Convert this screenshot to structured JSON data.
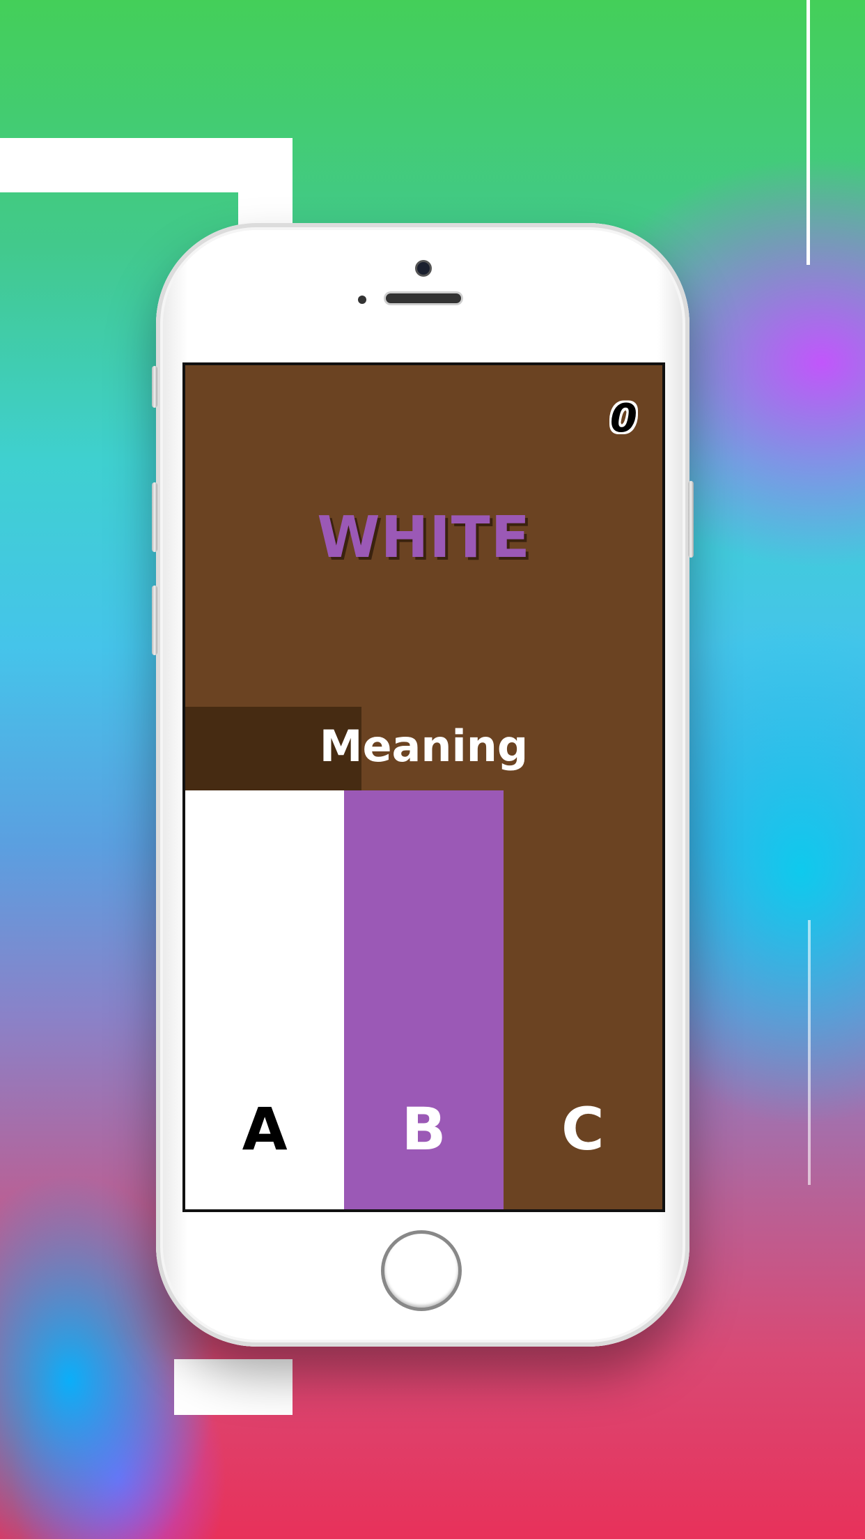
{
  "game": {
    "score": "0",
    "word": "WHITE",
    "mode_label": "Meaning",
    "timer_fraction": 0.37
  },
  "answers": [
    {
      "label": "A",
      "color": "#ffffff",
      "text_color": "#000000"
    },
    {
      "label": "B",
      "color": "#9b59b6",
      "text_color": "#ffffff"
    },
    {
      "label": "C",
      "color": "#6b4322",
      "text_color": "#ffffff"
    }
  ],
  "colors": {
    "screen_background": "#6b4322",
    "word_color": "#9b59b6",
    "phone_body": "#ffffff"
  }
}
